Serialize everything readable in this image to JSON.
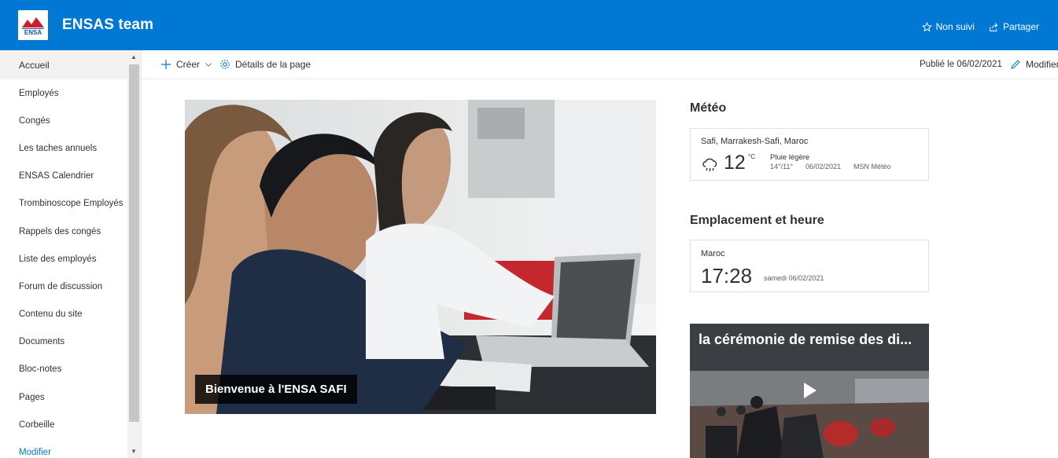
{
  "header": {
    "site_title": "ENSAS team",
    "logo_text": "ENSA",
    "follow_label": "Non suivi",
    "share_label": "Partager",
    "brand_color": "#0078d4"
  },
  "nav": {
    "items": [
      {
        "label": "Accueil",
        "active": true
      },
      {
        "label": "Employés"
      },
      {
        "label": "Congés"
      },
      {
        "label": "Les taches annuels"
      },
      {
        "label": "ENSAS Calendrier"
      },
      {
        "label": "Trombinoscope Employés"
      },
      {
        "label": "Rappels des congés"
      },
      {
        "label": "Liste des employés"
      },
      {
        "label": "Forum de discussion"
      },
      {
        "label": "Contenu du site"
      },
      {
        "label": "Documents"
      },
      {
        "label": "Bloc-notes"
      },
      {
        "label": "Pages"
      },
      {
        "label": "Corbeille"
      },
      {
        "label": "Modifier",
        "link": true
      }
    ]
  },
  "commandbar": {
    "create_label": "Créer",
    "details_label": "Détails de la page",
    "published_label": "Publié le 06/02/2021",
    "edit_label": "Modifier"
  },
  "hero": {
    "caption": "Bienvenue à l'ENSA SAFI"
  },
  "weather": {
    "title": "Météo",
    "location": "Safi, Marrakesh-Safi, Maroc",
    "temperature": "12",
    "unit": "°C",
    "condition": "Pluie légère",
    "range": "14°/11°",
    "date": "06/02/2021",
    "source": "MSN Météo",
    "icon": "cloud-rain-icon"
  },
  "clock": {
    "title": "Emplacement et heure",
    "location": "Maroc",
    "time": "17:28",
    "date": "samedi 06/02/2021"
  },
  "video": {
    "title": "la cérémonie de remise des di..."
  }
}
